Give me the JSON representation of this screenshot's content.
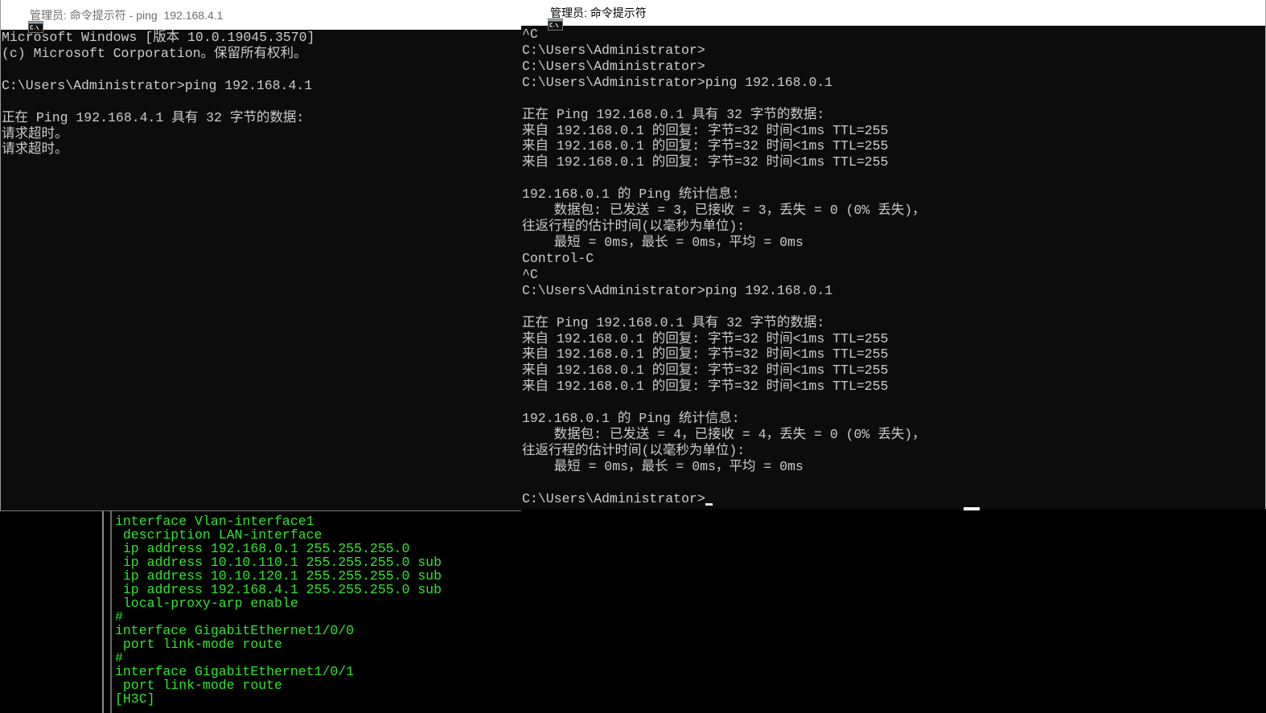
{
  "colors": {
    "console_bg": "#0c0c0c",
    "console_text": "#cccccc",
    "switch_text": "#2ee62e"
  },
  "icons": {
    "title_icon": "command-prompt-icon"
  },
  "windows": {
    "left": {
      "title": "管理员: 命令提示符 - ping  192.168.4.1",
      "lines": [
        "Microsoft Windows [版本 10.0.19045.3570]",
        "(c) Microsoft Corporation。保留所有权利。",
        "",
        "C:\\Users\\Administrator>ping 192.168.4.1",
        "",
        "正在 Ping 192.168.4.1 具有 32 字节的数据:",
        "请求超时。",
        "请求超时。"
      ]
    },
    "right": {
      "title": "管理员: 命令提示符",
      "lines": [
        "^C",
        "C:\\Users\\Administrator>",
        "C:\\Users\\Administrator>",
        "C:\\Users\\Administrator>ping 192.168.0.1",
        "",
        "正在 Ping 192.168.0.1 具有 32 字节的数据:",
        "来自 192.168.0.1 的回复: 字节=32 时间<1ms TTL=255",
        "来自 192.168.0.1 的回复: 字节=32 时间<1ms TTL=255",
        "来自 192.168.0.1 的回复: 字节=32 时间<1ms TTL=255",
        "",
        "192.168.0.1 的 Ping 统计信息:",
        "    数据包: 已发送 = 3，已接收 = 3，丢失 = 0 (0% 丢失)，",
        "往返行程的估计时间(以毫秒为单位):",
        "    最短 = 0ms，最长 = 0ms，平均 = 0ms",
        "Control-C",
        "^C",
        "C:\\Users\\Administrator>ping 192.168.0.1",
        "",
        "正在 Ping 192.168.0.1 具有 32 字节的数据:",
        "来自 192.168.0.1 的回复: 字节=32 时间<1ms TTL=255",
        "来自 192.168.0.1 的回复: 字节=32 时间<1ms TTL=255",
        "来自 192.168.0.1 的回复: 字节=32 时间<1ms TTL=255",
        "来自 192.168.0.1 的回复: 字节=32 时间<1ms TTL=255",
        "",
        "192.168.0.1 的 Ping 统计信息:",
        "    数据包: 已发送 = 4，已接收 = 4，丢失 = 0 (0% 丢失)，",
        "往返行程的估计时间(以毫秒为单位):",
        "    最短 = 0ms，最长 = 0ms，平均 = 0ms",
        "",
        "C:\\Users\\Administrator>"
      ]
    }
  },
  "switch_console": {
    "lines": [
      "interface Vlan-interface1",
      " description LAN-interface",
      " ip address 192.168.0.1 255.255.255.0",
      " ip address 10.10.110.1 255.255.255.0 sub",
      " ip address 10.10.120.1 255.255.255.0 sub",
      " ip address 192.168.4.1 255.255.255.0 sub",
      " local-proxy-arp enable",
      "#",
      "interface GigabitEthernet1/0/0",
      " port link-mode route",
      "#",
      "interface GigabitEthernet1/0/1",
      " port link-mode route",
      "[H3C]"
    ]
  }
}
